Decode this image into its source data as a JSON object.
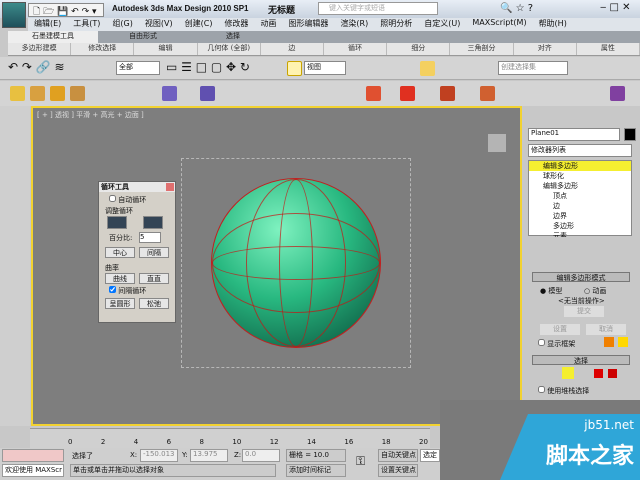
{
  "title": {
    "app": "Autodesk 3ds Max Design 2010 SP1",
    "doc": "无标题",
    "search_placeholder": "键入关键字或短语"
  },
  "menu": [
    "编辑(E)",
    "工具(T)",
    "组(G)",
    "视图(V)",
    "创建(C)",
    "修改器",
    "动画",
    "图形编辑器",
    "渲染(R)",
    "照明分析",
    "自定义(U)",
    "MAXScript(M)",
    "帮助(H)"
  ],
  "ribbon_tabs": [
    "石墨建模工具",
    "自由形式",
    "选择"
  ],
  "ribbon_panels": [
    "多边形建模",
    "修改选择",
    "编辑",
    "几何体 (全部)",
    "边",
    "循环",
    "细分",
    "三角剖分",
    "对齐",
    "属性"
  ],
  "toolbar": {
    "filter": "全部",
    "coord": "视图",
    "named_sel": "创建选择集"
  },
  "viewport": {
    "label": "[ + ] 透视 ] 平滑 + 高光 + 边面 ]"
  },
  "loop_tool": {
    "title": "循环工具",
    "auto_loop": "自动循环",
    "adjust": "调整循环",
    "percent_label": "百分比:",
    "percent": "5",
    "center": "中心",
    "spacing": "间隔",
    "curve": "曲率",
    "curve_btn": "曲线",
    "straight": "直直",
    "space_loop": "间隔循环",
    "circle": "呈圆形",
    "relax": "松弛"
  },
  "command": {
    "object_name": "Plane01",
    "modifier_list": "修改器列表",
    "stack": [
      "编辑多边形",
      "球形化",
      "编辑多边形",
      "顶点",
      "边",
      "边界",
      "多边形",
      "元素"
    ],
    "rollout1": "编辑多边形模式",
    "model": "模型",
    "animate": "动画",
    "no_op": "<无当前操作>",
    "commit": "提交",
    "settings": "设置",
    "cancel": "取消",
    "show_cage": "显示框架",
    "rollout2": "选择",
    "use_stack": "使用堆栈选择"
  },
  "timeline": {
    "ticks": [
      "0",
      "2",
      "4",
      "6",
      "8",
      "10",
      "12",
      "14",
      "16",
      "18",
      "20"
    ]
  },
  "status": {
    "welcome": "欢迎使用 MAXScr",
    "selected": "选择了",
    "x": "-150.013",
    "y": "13.975",
    "z": "0.0",
    "grid": "栅格 = 10.0",
    "prompt": "单击或单击并拖动以选择对象",
    "add_tag": "添加时间标记",
    "auto_key": "自动关键点",
    "set_key": "设置关键点",
    "sel_btn": "选定"
  },
  "watermark": {
    "site": "jb51.net",
    "name": "脚本之家"
  }
}
